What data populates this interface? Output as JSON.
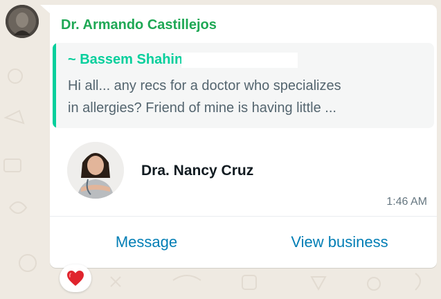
{
  "message": {
    "sender": "Dr. Armando Castillejos",
    "quote": {
      "author": "~ Bassem Shahin",
      "text_line1": "Hi all... any recs for a doctor who specializes",
      "text_line2": "in allergies? Friend of mine is having little ..."
    },
    "contact": {
      "name": "Dra. Nancy Cruz"
    },
    "time": "1:46 AM",
    "actions": {
      "message_label": "Message",
      "view_business_label": "View business"
    },
    "reaction": {
      "emoji_icon": "red-heart-icon"
    }
  },
  "colors": {
    "sender_green": "#1fa855",
    "quote_accent": "#06cf9c",
    "link_blue": "#027eb5",
    "reaction_red": "#e0242d"
  }
}
